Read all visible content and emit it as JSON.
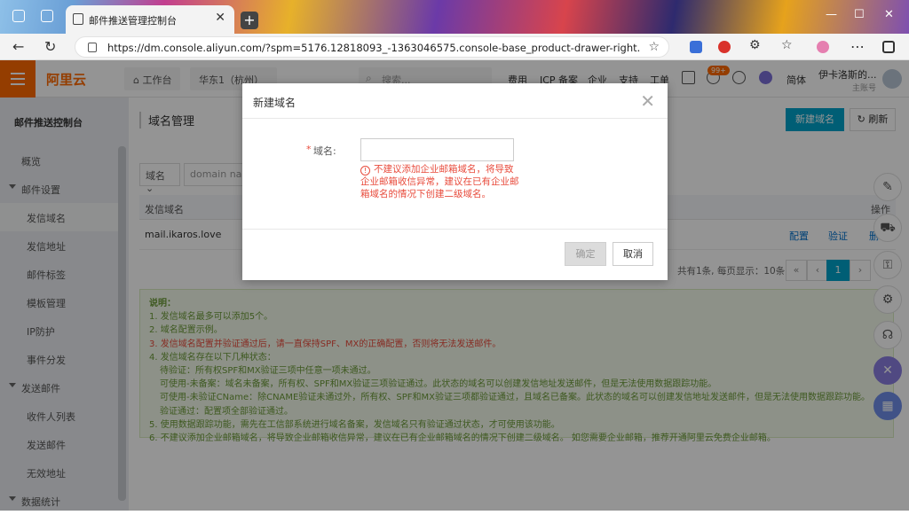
{
  "browser": {
    "tab_title": "邮件推送管理控制台",
    "url": "https://dm.console.aliyun.com/?spm=5176.12818093_-1363046575.console-base_product-drawer-right.ddirectmail.1b4..."
  },
  "header": {
    "logo": "阿里云",
    "workbench": "工作台",
    "region": "华东1（杭州）",
    "search_placeholder": "搜索...",
    "links": [
      "费用",
      "ICP 备案",
      "企业",
      "支持",
      "工单"
    ],
    "badge": "99+",
    "lang": "简体",
    "user_name": "伊卡洛斯的...",
    "user_role": "主账号"
  },
  "sidebar": {
    "title": "邮件推送控制台",
    "items": [
      {
        "label": "概览",
        "level": 0
      },
      {
        "label": "邮件设置",
        "level": 0,
        "group": true
      },
      {
        "label": "发信域名",
        "level": 1,
        "active": true
      },
      {
        "label": "发信地址",
        "level": 1
      },
      {
        "label": "邮件标签",
        "level": 1
      },
      {
        "label": "模板管理",
        "level": 1
      },
      {
        "label": "IP防护",
        "level": 1
      },
      {
        "label": "事件分发",
        "level": 1
      },
      {
        "label": "发送邮件",
        "level": 0,
        "group": true
      },
      {
        "label": "收件人列表",
        "level": 1
      },
      {
        "label": "发送邮件",
        "level": 1
      },
      {
        "label": "无效地址",
        "level": 1
      },
      {
        "label": "数据统计",
        "level": 0,
        "group": true
      }
    ]
  },
  "main": {
    "page_title": "域名管理",
    "new_domain_button": "新建域名",
    "refresh_button": "刷新",
    "filter_select": "域名",
    "filter_placeholder": "domain name",
    "table": {
      "col_domain": "发信域名",
      "col_action": "操作",
      "rows": [
        {
          "domain": "mail.ikaros.love",
          "actions": [
            "配置",
            "验证",
            "删"
          ]
        }
      ]
    },
    "pagination": {
      "summary": "共有1条, 每页显示：10条",
      "first": "«",
      "prev": "‹",
      "current": "1",
      "next": "›"
    },
    "notes": {
      "title": "说明：",
      "lines": [
        "1. 发信域名最多可以添加5个。",
        "2. 域名配置示例。",
        "3. 发信域名配置并验证通过后，请一直保持SPF、MX的正确配置，否则将无法发送邮件。",
        "4. 发信域名存在以下几种状态：",
        "待验证：所有权SPF和MX验证三项中任意一项未通过。",
        "可使用-未备案：域名未备案，所有权、SPF和MX验证三项验证通过。此状态的域名可以创建发信地址发送邮件，但是无法使用数据跟踪功能。",
        "可使用-未验证CName：除CNAME验证未通过外，所有权、SPF和MX验证三项都验证通过，且域名已备案。此状态的域名可以创建发信地址发送邮件，但是无法使用数据跟踪功能。",
        "验证通过：配置项全部验证通过。",
        "5. 使用数据跟踪功能，需先在工信部系统进行域名备案，发信域名只有验证通过状态，才可使用该功能。",
        "6. 不建议添加企业邮箱域名，将导致企业邮箱收信异常，建议在已有企业邮箱域名的情况下创建二级域名。 如您需要企业邮箱，推荐开通阿里云免费企业邮箱。"
      ]
    }
  },
  "modal": {
    "title": "新建域名",
    "field_label": "域名:",
    "required_mark": "*",
    "field_value": "",
    "error_text": "不建议添加企业邮箱域名，将导致企业邮箱收信异常，建议在已有企业邮箱域名的情况下创建二级域名。",
    "ok_button": "确定",
    "cancel_button": "取消"
  },
  "colors": {
    "brand": "#ff6a00",
    "primary": "#00a2ca",
    "error": "#e84c3d"
  }
}
